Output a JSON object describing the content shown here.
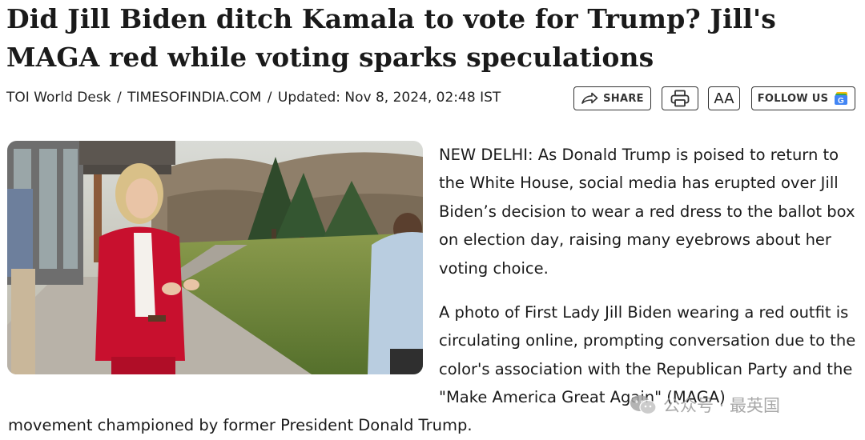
{
  "article": {
    "headline_line1": "Did Jill Biden ditch Kamala to vote for Trump? Jill's",
    "headline_line2": "MAGA red while voting sparks speculations",
    "byline": {
      "author": "TOI World Desk",
      "source": "TIMESOFINDIA.COM",
      "updated": "Updated: Nov 8, 2024, 02:48 IST"
    },
    "toolbar": {
      "share_label": "SHARE",
      "font_size_label": "AA",
      "follow_label": "FOLLOW US",
      "google_badge": "G"
    },
    "paragraph1": "NEW DELHI: As Donald Trump is poised to return to the White House, social media has erupted over Jill Biden’s decision to wear a red dress to the ballot box on election day, raising many eyebrows about her voting choice.",
    "paragraph2": "A photo of First Lady Jill Biden wearing a red outfit is circulating online, prompting conversation due to the color's association with the Republican Party and the \"Make America Great Again\" (MAGA)",
    "paragraph2_tail": "movement championed by former President Donald Trump."
  },
  "watermark": {
    "text": "公众号 · 最英国"
  },
  "icons": {
    "share": "share-arrow-icon",
    "print": "printer-icon",
    "google_news": "google-news-icon",
    "wechat": "wechat-icon"
  },
  "colors": {
    "dress_red": "#c8102e",
    "google_blue": "#4285f4",
    "text": "#1a1a1a"
  }
}
